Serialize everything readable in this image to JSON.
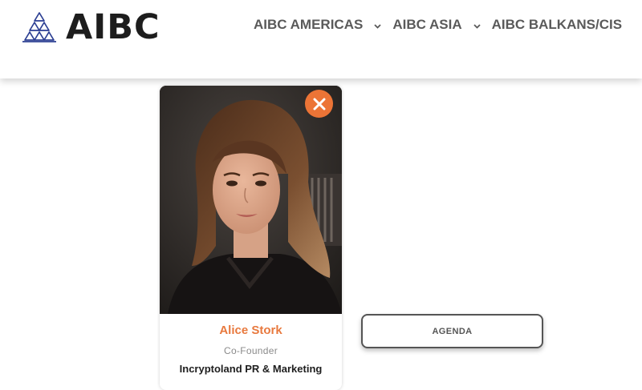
{
  "logo": {
    "text": "AIBC"
  },
  "nav": [
    {
      "label": "AIBC AMERICAS",
      "has_dropdown": true
    },
    {
      "label": "AIBC ASIA",
      "has_dropdown": true
    },
    {
      "label": "AIBC BALKANS/CIS",
      "has_dropdown": false
    }
  ],
  "speaker": {
    "name": "Alice Stork",
    "role": "Co-Founder",
    "company": "Incryptoland PR & Marketing"
  },
  "agenda_button": "AGENDA",
  "icons": {
    "logo_mark": "triangle-logo-icon",
    "dropdown": "chevron-down-icon",
    "close": "close-icon"
  },
  "colors": {
    "accent": "#ec7436",
    "name_text": "#e8793e",
    "logo_mark": "#2c3f93",
    "logo_text": "#1d1d1d",
    "nav_text": "#5a5a5a"
  }
}
